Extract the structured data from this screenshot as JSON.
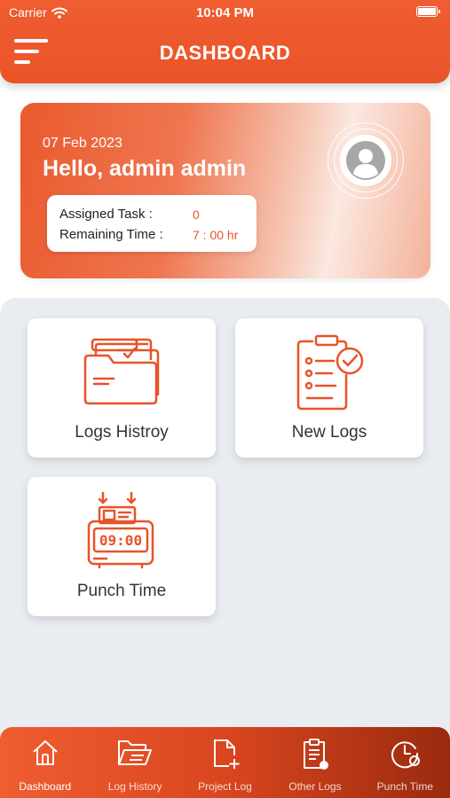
{
  "status_bar": {
    "carrier": "Carrier",
    "time": "10:04 PM"
  },
  "header": {
    "title": "DASHBOARD",
    "menu_icon": "hamburger-menu-icon"
  },
  "greeting": {
    "date": "07 Feb 2023",
    "hello": "Hello, admin admin",
    "assigned_label": "Assigned Task :",
    "assigned_value": "0",
    "remaining_label": "Remaining Time :",
    "remaining_value": "7 : 00 hr"
  },
  "tiles": [
    {
      "label": "Logs Histroy",
      "icon": "folder-check-icon"
    },
    {
      "label": "New Logs",
      "icon": "checklist-clipboard-icon"
    },
    {
      "label": "Punch Time",
      "icon": "punch-clock-icon"
    }
  ],
  "tabs": [
    {
      "label": "Dashboard",
      "icon": "home-icon",
      "active": true
    },
    {
      "label": "Log History",
      "icon": "folder-list-icon"
    },
    {
      "label": "Project Log",
      "icon": "add-document-icon"
    },
    {
      "label": "Other Logs",
      "icon": "clipboard-icon"
    },
    {
      "label": "Punch Time",
      "icon": "clock-icon"
    }
  ],
  "colors": {
    "accent": "#ea5428",
    "tab_dark": "#9a2a0e",
    "background": "#e9edf1"
  }
}
